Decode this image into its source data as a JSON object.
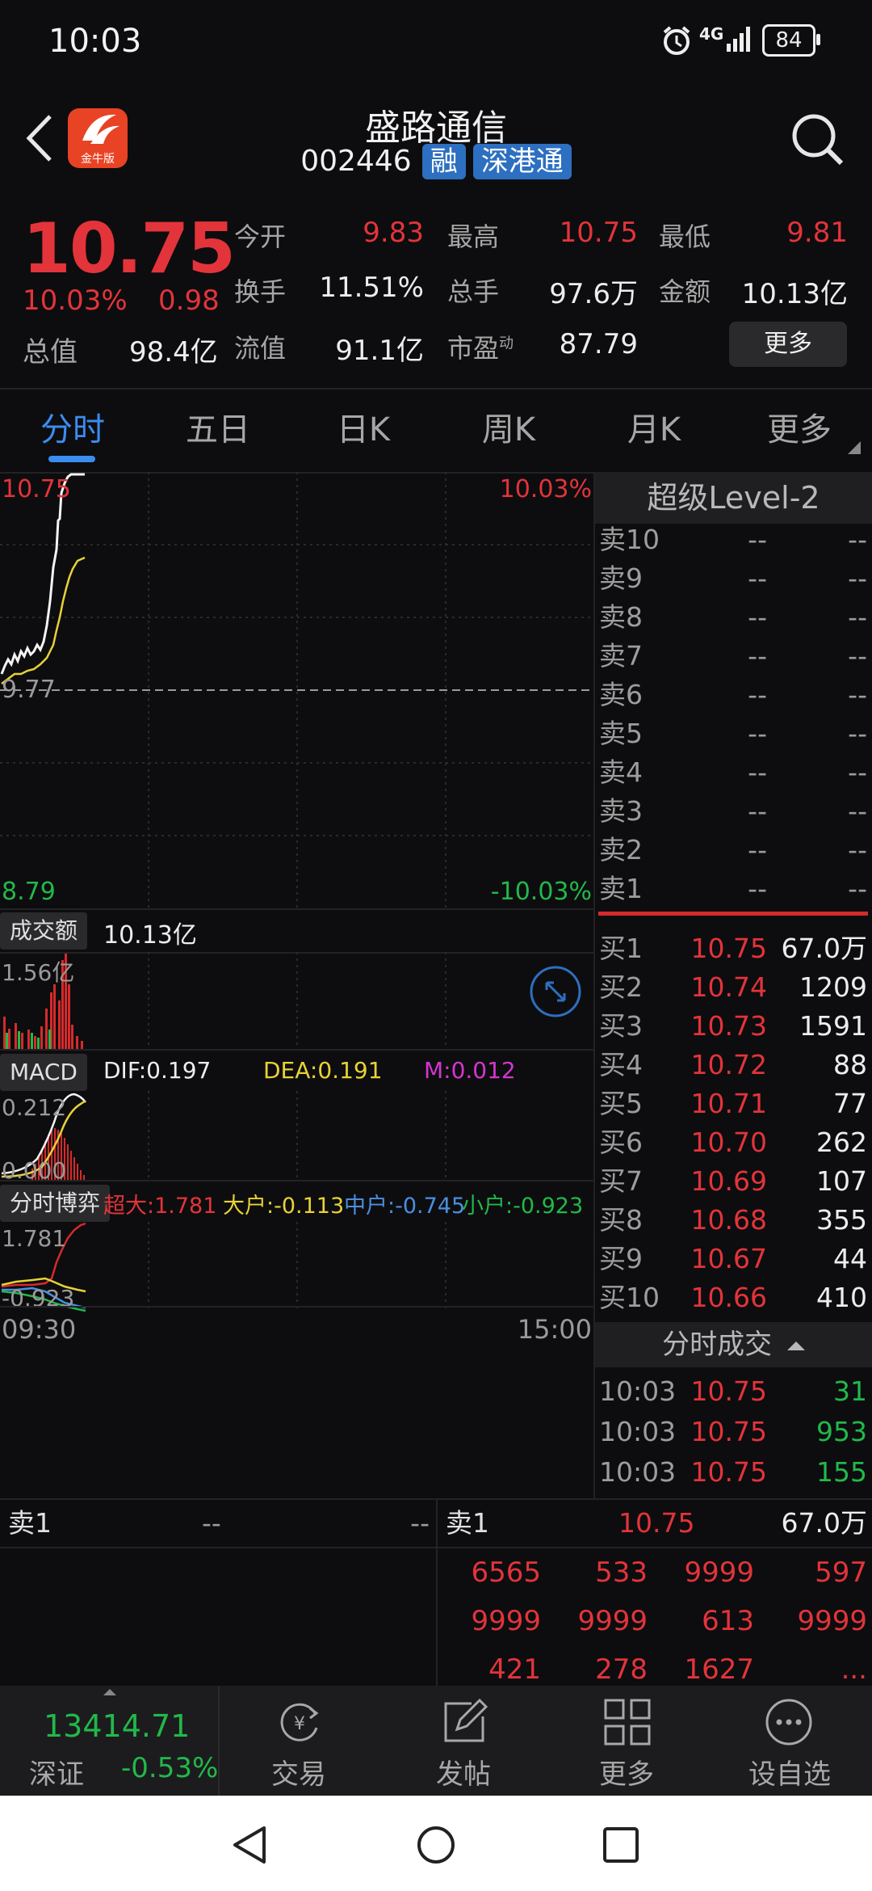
{
  "status_bar": {
    "time": "10:03",
    "signal": "4G",
    "battery": "84"
  },
  "header": {
    "title": "盛路通信",
    "code": "002446",
    "tag1": "融",
    "tag2": "深港通",
    "logo_text": "金牛版"
  },
  "quote": {
    "price": "10.75",
    "pct": "10.03%",
    "change": "0.98",
    "rows": [
      [
        {
          "label": "今开",
          "value": "9.83"
        },
        {
          "label": "最高",
          "value": "10.75"
        },
        {
          "label": "最低",
          "value": "9.81"
        }
      ],
      [
        {
          "label": "换手",
          "value": "11.51%"
        },
        {
          "label": "总手",
          "value": "97.6万"
        },
        {
          "label": "金额",
          "value": "10.13亿"
        }
      ],
      [
        {
          "label": "总值",
          "value": "98.4亿"
        },
        {
          "label": "流值",
          "value": "91.1亿"
        },
        {
          "label": "市盈",
          "sup": "动",
          "value": "87.79"
        }
      ]
    ],
    "more": "更多"
  },
  "tabs": [
    "分时",
    "五日",
    "日K",
    "周K",
    "月K",
    "更多"
  ],
  "chart": {
    "price_high": "10.75",
    "price_mid": "9.77",
    "price_low": "8.79",
    "pct_high": "10.03%",
    "pct_low": "-10.03%",
    "volume_label": "成交额",
    "volume_value": "10.13亿",
    "volume_max": "1.56亿",
    "macd_label": "MACD",
    "dif": "DIF:0.197",
    "dea": "DEA:0.191",
    "m": "M:0.012",
    "macd_max": "0.212",
    "macd_zero": "0.000",
    "flow_label": "分时博弈",
    "flow_super": "超大:1.781",
    "flow_big": "大户:-0.113",
    "flow_mid": "中户:-0.745",
    "flow_small": "小户:-0.923",
    "flow_max": "1.781",
    "flow_min": "-0.923",
    "time_start": "09:30",
    "time_end": "15:00"
  },
  "orderbook": {
    "title": "超级Level-2",
    "sells": [
      {
        "label": "卖10",
        "price": "--",
        "qty": "--"
      },
      {
        "label": "卖9",
        "price": "--",
        "qty": "--"
      },
      {
        "label": "卖8",
        "price": "--",
        "qty": "--"
      },
      {
        "label": "卖7",
        "price": "--",
        "qty": "--"
      },
      {
        "label": "卖6",
        "price": "--",
        "qty": "--"
      },
      {
        "label": "卖5",
        "price": "--",
        "qty": "--"
      },
      {
        "label": "卖4",
        "price": "--",
        "qty": "--"
      },
      {
        "label": "卖3",
        "price": "--",
        "qty": "--"
      },
      {
        "label": "卖2",
        "price": "--",
        "qty": "--"
      },
      {
        "label": "卖1",
        "price": "--",
        "qty": "--"
      }
    ],
    "buys": [
      {
        "label": "买1",
        "price": "10.75",
        "qty": "67.0万"
      },
      {
        "label": "买2",
        "price": "10.74",
        "qty": "1209"
      },
      {
        "label": "买3",
        "price": "10.73",
        "qty": "1591"
      },
      {
        "label": "买4",
        "price": "10.72",
        "qty": "88"
      },
      {
        "label": "买5",
        "price": "10.71",
        "qty": "77"
      },
      {
        "label": "买6",
        "price": "10.70",
        "qty": "262"
      },
      {
        "label": "买7",
        "price": "10.69",
        "qty": "107"
      },
      {
        "label": "买8",
        "price": "10.68",
        "qty": "355"
      },
      {
        "label": "买9",
        "price": "10.67",
        "qty": "44"
      },
      {
        "label": "买10",
        "price": "10.66",
        "qty": "410"
      }
    ],
    "ticks_title": "分时成交",
    "ticks": [
      {
        "time": "10:03",
        "price": "10.75",
        "qty": "31"
      },
      {
        "time": "10:03",
        "price": "10.75",
        "qty": "953"
      },
      {
        "time": "10:03",
        "price": "10.75",
        "qty": "155"
      }
    ]
  },
  "bottom": {
    "left": {
      "label": "卖1",
      "price": "--",
      "qty": "--"
    },
    "right": {
      "label": "卖1",
      "price": "10.75",
      "qty": "67.0万"
    },
    "queue": [
      [
        "6565",
        "533",
        "9999",
        "597"
      ],
      [
        "9999",
        "9999",
        "613",
        "9999"
      ],
      [
        "421",
        "278",
        "1627",
        "..."
      ]
    ]
  },
  "nav": {
    "index_value": "13414.71",
    "index_name": "深证",
    "index_change": "-0.53%",
    "items": [
      "交易",
      "发帖",
      "更多",
      "设自选"
    ]
  }
}
